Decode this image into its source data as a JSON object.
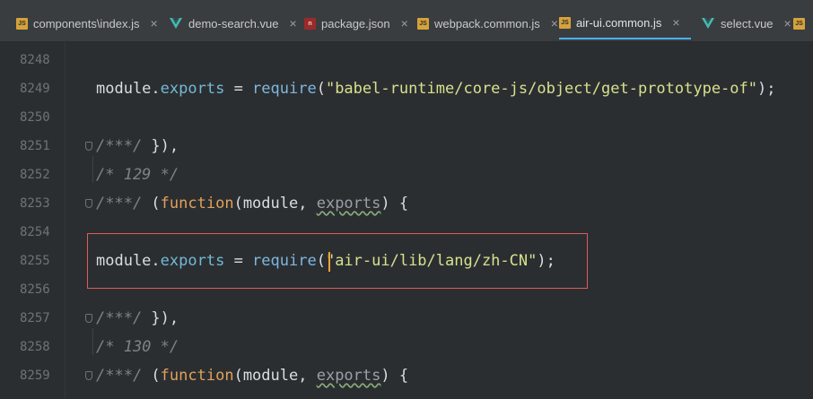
{
  "tabs": [
    {
      "label": "components\\index.js",
      "icon": "javascript-file-icon",
      "close": "×",
      "active": false
    },
    {
      "label": "demo-search.vue",
      "icon": "vue-file-icon",
      "close": "×",
      "active": false
    },
    {
      "label": "package.json",
      "icon": "json-file-icon",
      "close": "×",
      "active": false
    },
    {
      "label": "webpack.common.js",
      "icon": "javascript-file-icon",
      "close": "×",
      "active": false
    },
    {
      "label": "air-ui.common.js",
      "icon": "javascript-file-icon",
      "close": "×",
      "active": true
    },
    {
      "label": "select.vue",
      "icon": "vue-file-icon",
      "close": "×",
      "active": false
    }
  ],
  "editor": {
    "lines": [
      {
        "number": "8248",
        "code": ""
      },
      {
        "number": "8249",
        "code": {
          "object": "module",
          "dot": ".",
          "property": "exports",
          "equals": " = ",
          "function": "require",
          "open": "(",
          "string": "\"babel-runtime/core-js/object/get-prototype-of\"",
          "close": ");"
        }
      },
      {
        "number": "8250",
        "code": ""
      },
      {
        "number": "8251",
        "code": {
          "comment": "/***/",
          "rest": " }),"
        }
      },
      {
        "number": "8252",
        "code": {
          "comment": "/* 129 */"
        }
      },
      {
        "number": "8253",
        "code": {
          "comment": "/***/",
          "open": " (",
          "keyword": "function",
          "params_open": "(",
          "param1": "module",
          "comma": ", ",
          "param2": "exports",
          "params_close": ") {"
        }
      },
      {
        "number": "8254",
        "code": ""
      },
      {
        "number": "8255",
        "code": {
          "object": "module",
          "dot": ".",
          "property": "exports",
          "equals": " = ",
          "function": "require",
          "open": "(",
          "string": "\"air-ui/lib/lang/zh-CN\"",
          "close": ");"
        }
      },
      {
        "number": "8256",
        "code": ""
      },
      {
        "number": "8257",
        "code": {
          "comment": "/***/",
          "rest": " }),"
        }
      },
      {
        "number": "8258",
        "code": {
          "comment": "/* 130 */"
        }
      },
      {
        "number": "8259",
        "code": {
          "comment": "/***/",
          "open": " (",
          "keyword": "function",
          "params_open": "(",
          "param1": "module",
          "comma": ", ",
          "param2": "exports",
          "params_close": ") {"
        }
      }
    ]
  }
}
